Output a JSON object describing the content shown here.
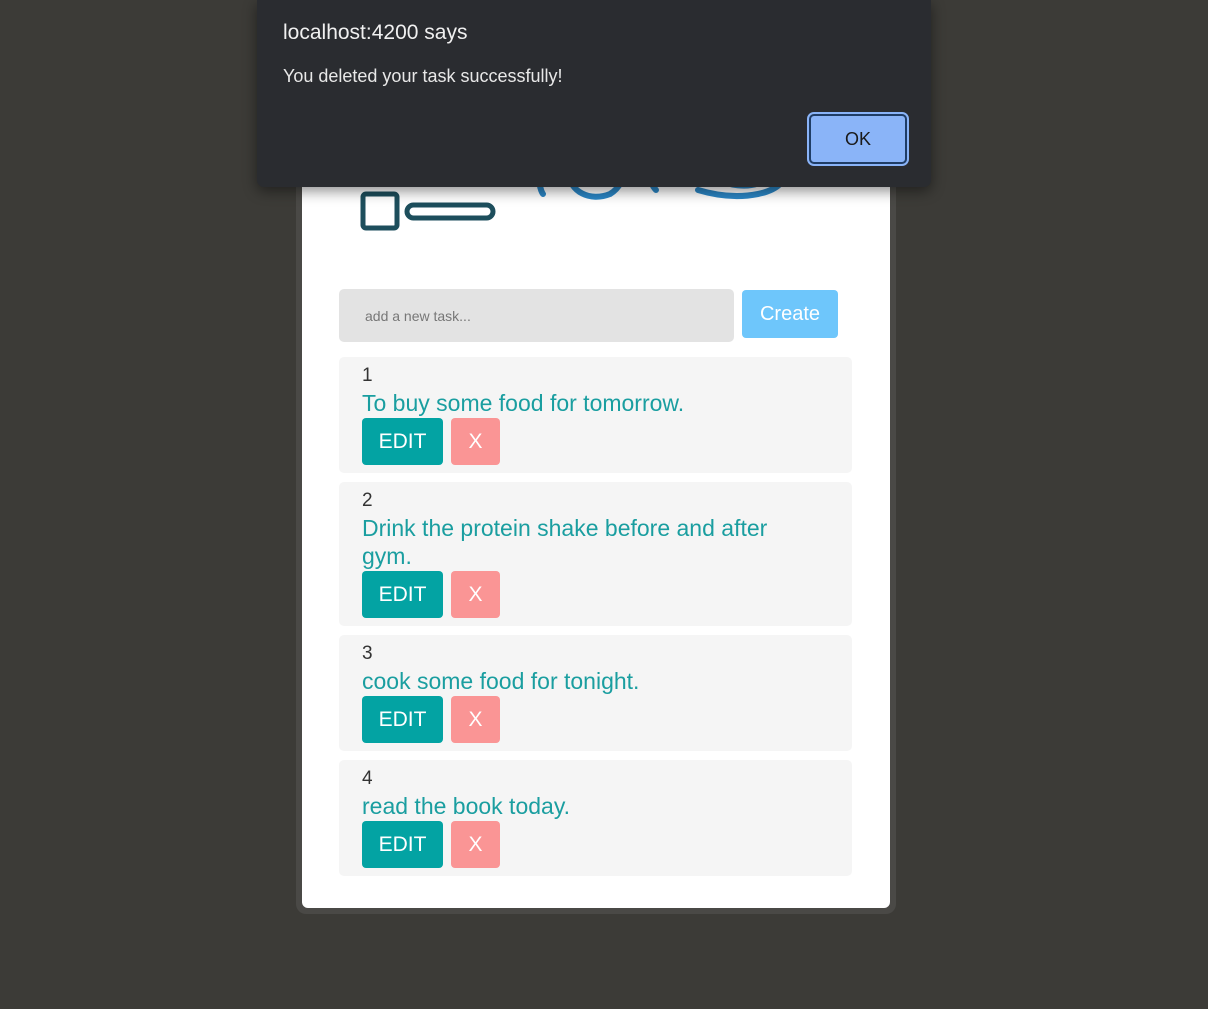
{
  "dialog": {
    "title": "localhost:4200 says",
    "message": "You deleted your task successfully!",
    "ok_label": "OK"
  },
  "form": {
    "input_placeholder": "add a new task...",
    "input_value": "",
    "create_label": "Create"
  },
  "tasks": [
    {
      "number": "1",
      "text": "To buy some food for tomorrow.",
      "edit_label": "EDIT",
      "delete_label": "X"
    },
    {
      "number": "2",
      "text": "Drink the protein shake before and after gym.",
      "edit_label": "EDIT",
      "delete_label": "X"
    },
    {
      "number": "3",
      "text": "cook some food for tonight.",
      "edit_label": "EDIT",
      "delete_label": "X"
    },
    {
      "number": "4",
      "text": "read the book today.",
      "edit_label": "EDIT",
      "delete_label": "X"
    }
  ],
  "colors": {
    "background": "#3c3b37",
    "task_text": "#1a9ea0",
    "edit_button": "#03a3a3",
    "delete_button": "#fa9595",
    "create_button": "#6ec6fb",
    "dialog_ok": "#8ab4f8"
  },
  "icons": {
    "logo": "todo-list-logo-icon"
  }
}
